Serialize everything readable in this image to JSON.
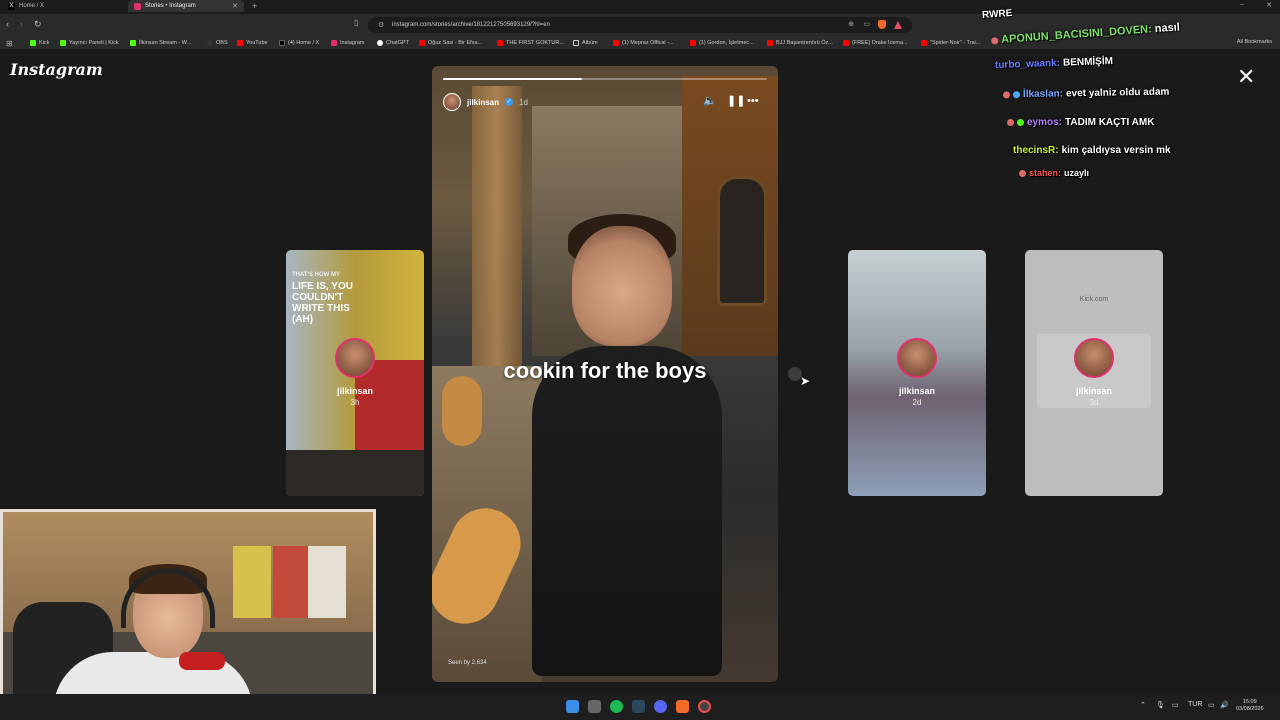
{
  "browser": {
    "tabs": [
      {
        "label": "Home / X",
        "active": false
      },
      {
        "label": "Stories • Instagram",
        "active": true
      }
    ],
    "new_tab": "+",
    "url": "instagram.com/stories/archive/18122127505693129/?hl=en",
    "bookmarks": [
      {
        "label": "Kick",
        "color": "#53fc18"
      },
      {
        "label": "Yayıncı Paneli | Kick",
        "color": "#53fc18"
      },
      {
        "label": "İlkinsan Stream - W...",
        "color": "#53fc18"
      },
      {
        "label": "OBS",
        "color": "#333333"
      },
      {
        "label": "YouTube",
        "color": "#ff0000"
      },
      {
        "label": "(4) Home / X",
        "color": "#000000"
      },
      {
        "label": "Instagram",
        "color": "#e1306c"
      },
      {
        "label": "ChatGPT",
        "color": "#ffffff"
      },
      {
        "label": "Oğuz Sasi - Bir Efsa...",
        "color": "#ff0000"
      },
      {
        "label": "THE FIRST GOKTUR...",
        "color": "#ff0000"
      },
      {
        "label": "Albüm",
        "color": "#cccccc"
      },
      {
        "label": "(1) Mepraz Offical -...",
        "color": "#ff0000"
      },
      {
        "label": "(1) Gordon, İşletmec...",
        "color": "#ff0000"
      },
      {
        "label": "BJJ Başantrenörü Öz...",
        "color": "#ff0000"
      },
      {
        "label": "(FREE) Drake Icema...",
        "color": "#ff0000"
      },
      {
        "label": "\"Spider-Noir\" - Trai...",
        "color": "#ff0000"
      }
    ],
    "all_bookmarks": "All Bookmarks"
  },
  "instagram": {
    "logo": "Instagram",
    "close_icon": "close-icon",
    "main_story": {
      "username": "jilkinsan",
      "time": "1d",
      "caption": "cookin for the boys",
      "seen_by": "Seen by 2,634",
      "progress": 0.43
    },
    "side_stories": [
      {
        "username": "jilkinsan",
        "age": "3h",
        "poster_line1": "THAT'S HOW MY",
        "poster_line2": "LIFE IS, YOU COULDN'T WRITE THIS (AH)"
      },
      {
        "username": "jilkinsan",
        "age": "2d"
      },
      {
        "username": "jilkinsan",
        "age": "3d",
        "kick_text": "Kick.com"
      }
    ]
  },
  "chat": [
    {
      "user": "",
      "text": "RWRE",
      "user_color": "#ffffff"
    },
    {
      "user": "APONUN_BACISINI_DOVEN:",
      "text": "nasıl",
      "user_color": "#7ee06b"
    },
    {
      "user": "turbo_waank:",
      "text": "BENMİŞİM",
      "user_color": "#6a7bff"
    },
    {
      "user": "İlkaslan:",
      "text": "evet yalniz oldu adam",
      "user_color": "#7aa7ff"
    },
    {
      "user": "eymos:",
      "text": "TADIM KAÇTI AMK",
      "user_color": "#b77bff"
    },
    {
      "user": "thecinsR:",
      "text": "kim çaldıysa versin mk",
      "user_color": "#c9f03a"
    },
    {
      "user": "stahen:",
      "text": "uzaylı",
      "user_color": "#ff4d4d"
    }
  ],
  "taskbar": {
    "language": "TUR",
    "time": "15:09",
    "date": "03/08/2026"
  }
}
